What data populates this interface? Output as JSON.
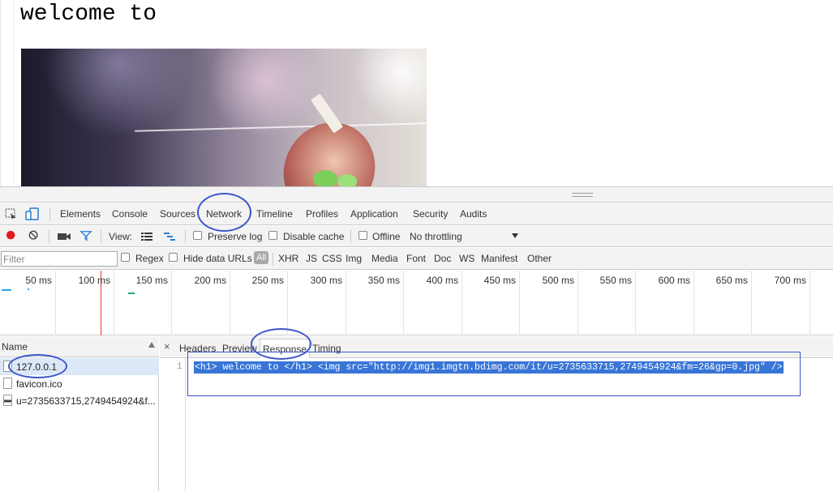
{
  "page": {
    "heading": "welcome to"
  },
  "devtools": {
    "tabs": [
      "Elements",
      "Console",
      "Sources",
      "Network",
      "Timeline",
      "Profiles",
      "Application",
      "Security",
      "Audits"
    ],
    "active_tab": "Network",
    "toolbar": {
      "view_label": "View:",
      "preserve_log": "Preserve log",
      "disable_cache": "Disable cache",
      "offline": "Offline",
      "throttling": "No throttling"
    },
    "filter": {
      "placeholder": "Filter",
      "regex": "Regex",
      "hide_data_urls": "Hide data URLs",
      "types": [
        "All",
        "XHR",
        "JS",
        "CSS",
        "Img",
        "Media",
        "Font",
        "Doc",
        "WS",
        "Manifest",
        "Other"
      ]
    },
    "timeline_ticks": [
      "50 ms",
      "100 ms",
      "150 ms",
      "200 ms",
      "250 ms",
      "300 ms",
      "350 ms",
      "400 ms",
      "450 ms",
      "500 ms",
      "550 ms",
      "600 ms",
      "650 ms",
      "700 ms"
    ],
    "requests": {
      "header": "Name",
      "items": [
        "127.0.0.1",
        "favicon.ico",
        "u=2735633715,2749454924&f..."
      ]
    },
    "detail": {
      "close": "×",
      "tabs": [
        "Headers",
        "Preview",
        "Response",
        "Timing"
      ],
      "active_tab": "Response",
      "line_number": "1",
      "response_body": "<h1> welcome to </h1> <img src=\"http://img1.imgtn.bdimg.com/it/u=2735633715,2749454924&fm=26&gp=0.jpg\" />"
    }
  },
  "colors": {
    "annotation": "#3d56c8",
    "selection": "#3875d7",
    "record_red": "#e21b1b",
    "filter_blue": "#2a7ad6"
  }
}
